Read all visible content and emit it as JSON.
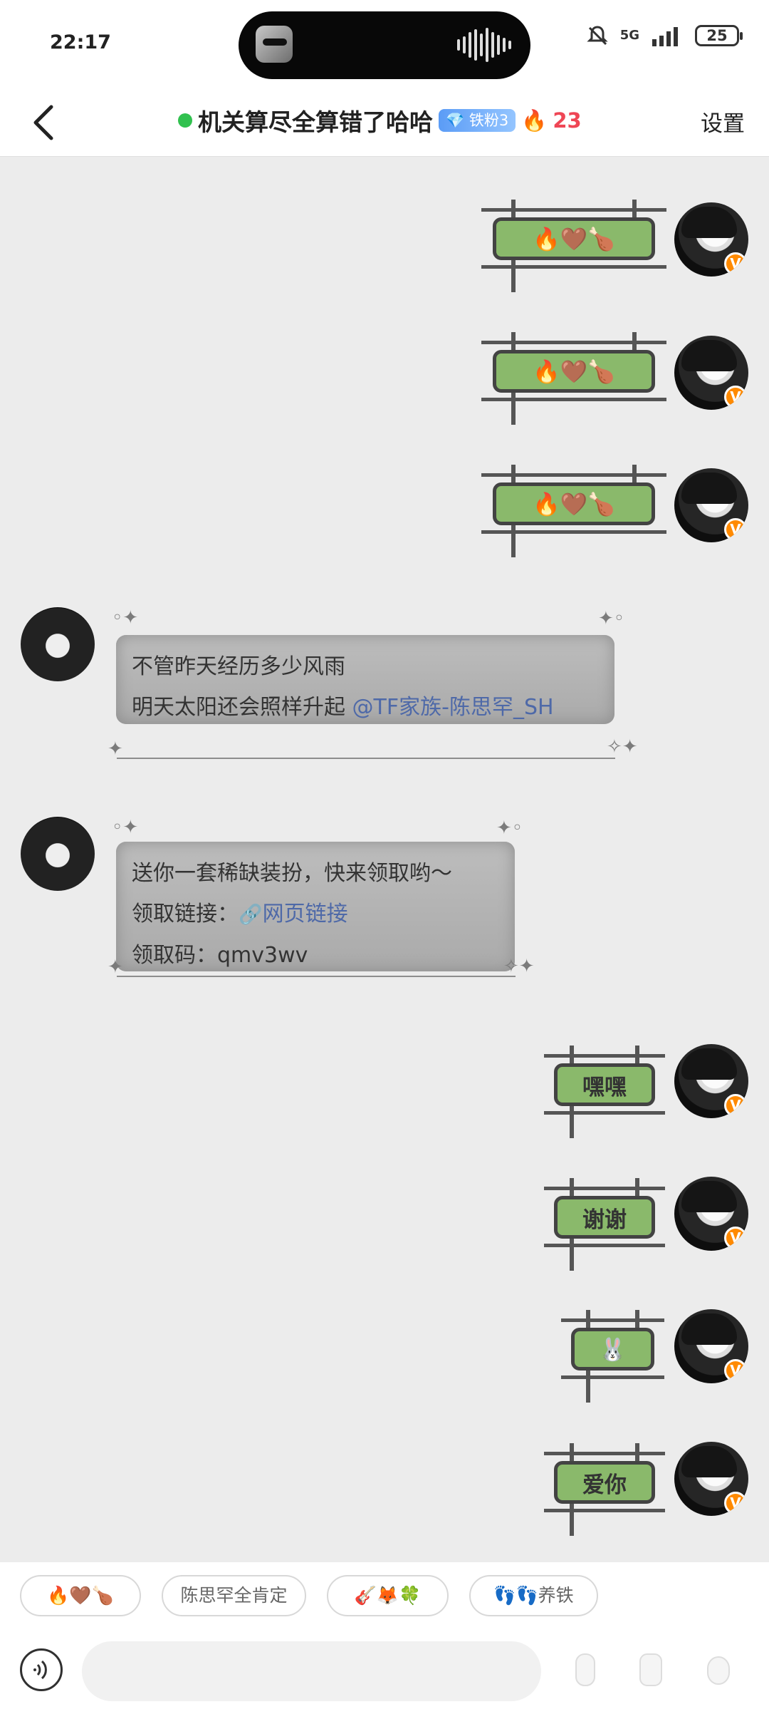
{
  "status_bar": {
    "time": "22:17",
    "network": "5G",
    "battery": "25"
  },
  "header": {
    "back_label": "<",
    "title": "机关算尽全算错了哈哈",
    "fan_badge": "铁粉3",
    "streak_count": "23",
    "settings_label": "设置"
  },
  "messages": [
    {
      "type": "sticker",
      "side": "right",
      "content": "🔥🤎🍗"
    },
    {
      "type": "sticker",
      "side": "right",
      "content": "🔥🤎🍗"
    },
    {
      "type": "sticker",
      "side": "right",
      "content": "🔥🤎🍗"
    },
    {
      "type": "text",
      "side": "left",
      "line1": "不管昨天经历多少风雨",
      "line2": "明天太阳还会照样升起 ",
      "mention": "@TF家族-陈思罕_SH"
    },
    {
      "type": "text",
      "side": "left",
      "line1": "送你一套稀缺装扮，快来领取哟～",
      "link_label": "领取链接：",
      "link_text": "网页链接",
      "code_label": "领取码：",
      "code": "qmv3wv"
    },
    {
      "type": "sticker",
      "side": "right",
      "content": "嘿嘿"
    },
    {
      "type": "sticker",
      "side": "right",
      "content": "谢谢"
    },
    {
      "type": "sticker",
      "side": "right",
      "content": "🐰"
    },
    {
      "type": "sticker",
      "side": "right",
      "content": "爱你"
    }
  ],
  "quick_replies": [
    "🔥🤎🍗",
    "陈思罕全肯定",
    "🎸🦊🍀",
    "👣👣养铁"
  ],
  "input": {
    "placeholder": ""
  },
  "colors": {
    "accent": "#ff8a00",
    "online": "#31c14f",
    "streak": "#ef4655",
    "link": "#4e69a8",
    "sign_green": "#8ab96b"
  }
}
